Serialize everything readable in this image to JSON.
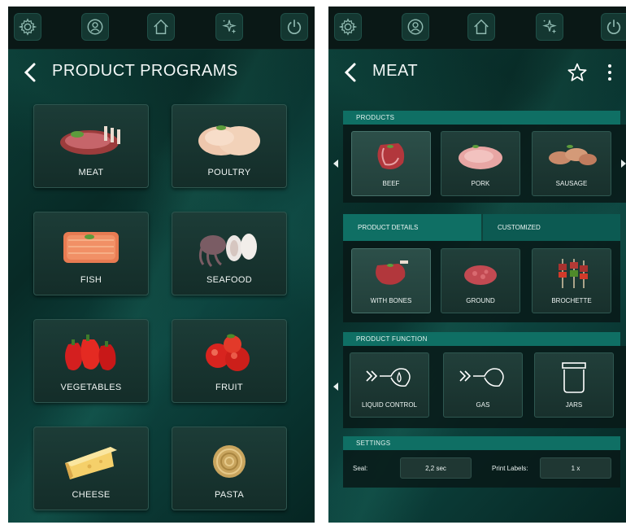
{
  "left_screen": {
    "title": "PRODUCT PROGRAMS",
    "tiles": [
      {
        "label": "MEAT",
        "icon": "meat-icon"
      },
      {
        "label": "POULTRY",
        "icon": "poultry-icon"
      },
      {
        "label": "FISH",
        "icon": "fish-icon"
      },
      {
        "label": "SEAFOOD",
        "icon": "seafood-icon"
      },
      {
        "label": "VEGETABLES",
        "icon": "vegetables-icon"
      },
      {
        "label": "FRUIT",
        "icon": "fruit-icon"
      },
      {
        "label": "CHEESE",
        "icon": "cheese-icon"
      },
      {
        "label": "PASTA",
        "icon": "pasta-icon"
      }
    ]
  },
  "right_screen": {
    "title": "MEAT",
    "products": {
      "header": "PRODUCTS",
      "items": [
        {
          "label": "BEEF",
          "selected": true
        },
        {
          "label": "PORK",
          "selected": false
        },
        {
          "label": "SAUSAGE",
          "selected": false
        }
      ]
    },
    "tabs": {
      "product_details": "PRODUCT DETAILS",
      "customized": "CUSTOMIZED"
    },
    "details": [
      {
        "label": "WITH BONES",
        "selected": true
      },
      {
        "label": "GROUND",
        "selected": false
      },
      {
        "label": "BROCHETTE",
        "selected": false
      }
    ],
    "function": {
      "header": "PRODUCT FUNCTION",
      "items": [
        {
          "label": "LIQUID CONTROL"
        },
        {
          "label": "GAS"
        },
        {
          "label": "JARS"
        }
      ]
    },
    "settings": {
      "header": "SETTINGS",
      "seal_label": "Seal:",
      "seal_value": "2,2 sec",
      "print_label": "Print Labels:",
      "print_value": "1 x"
    }
  },
  "topbar_icons": [
    "settings-icon",
    "user-icon",
    "home-icon",
    "magic-icon",
    "power-icon"
  ],
  "colors": {
    "accent": "#0f6f64",
    "background": "#0a3631",
    "topbar": "#0a1816"
  }
}
